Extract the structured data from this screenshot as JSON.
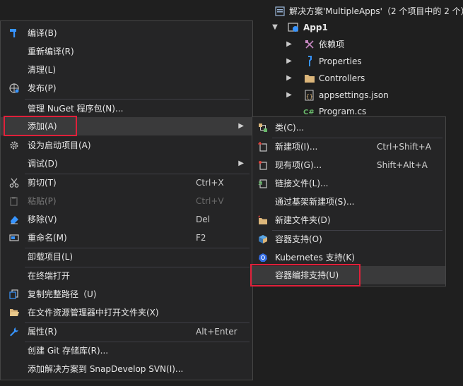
{
  "explorer": {
    "solution_label": "解决方案'MultipleApps'（2 个项目中的 2 个）",
    "project": "App1",
    "items": [
      {
        "label": "依赖项"
      },
      {
        "label": "Properties"
      },
      {
        "label": "Controllers"
      },
      {
        "label": "appsettings.json"
      },
      {
        "label": "Program.cs"
      }
    ]
  },
  "context_menu": {
    "items": [
      {
        "label": "编译(B)",
        "shortcut": ""
      },
      {
        "label": "重新编译(R)",
        "shortcut": ""
      },
      {
        "label": "清理(L)",
        "shortcut": ""
      },
      {
        "label": "发布(P)",
        "shortcut": ""
      },
      {
        "label": "管理 NuGet 程序包(N)...",
        "shortcut": ""
      },
      {
        "label": "添加(A)",
        "shortcut": ""
      },
      {
        "label": "设为启动项目(A)",
        "shortcut": ""
      },
      {
        "label": "调试(D)",
        "shortcut": ""
      },
      {
        "label": "剪切(T)",
        "shortcut": "Ctrl+X"
      },
      {
        "label": "粘贴(P)",
        "shortcut": "Ctrl+V"
      },
      {
        "label": "移除(V)",
        "shortcut": "Del"
      },
      {
        "label": "重命名(M)",
        "shortcut": "F2"
      },
      {
        "label": "卸载项目(L)",
        "shortcut": ""
      },
      {
        "label": "在终端打开",
        "shortcut": ""
      },
      {
        "label": "复制完整路径（U)",
        "shortcut": ""
      },
      {
        "label": "在文件资源管理器中打开文件夹(X)",
        "shortcut": ""
      },
      {
        "label": "属性(R)",
        "shortcut": "Alt+Enter"
      },
      {
        "label": "创建 Git 存储库(R)...",
        "shortcut": ""
      },
      {
        "label": "添加解决方案到 SnapDevelop SVN(I)...",
        "shortcut": ""
      }
    ]
  },
  "submenu": {
    "items": [
      {
        "label": "类(C)...",
        "shortcut": ""
      },
      {
        "label": "新建项(I)...",
        "shortcut": "Ctrl+Shift+A"
      },
      {
        "label": "现有项(G)...",
        "shortcut": "Shift+Alt+A"
      },
      {
        "label": "链接文件(L)...",
        "shortcut": ""
      },
      {
        "label": "通过基架新建项(S)...",
        "shortcut": ""
      },
      {
        "label": "新建文件夹(D)",
        "shortcut": ""
      },
      {
        "label": "容器支持(O)",
        "shortcut": ""
      },
      {
        "label": "Kubernetes 支持(K)",
        "shortcut": ""
      },
      {
        "label": "容器编排支持(U)",
        "shortcut": ""
      }
    ]
  },
  "colors": {
    "highlight_border": "#e0203a",
    "folder": "#dcb67a",
    "accent_blue": "#3794ff"
  }
}
